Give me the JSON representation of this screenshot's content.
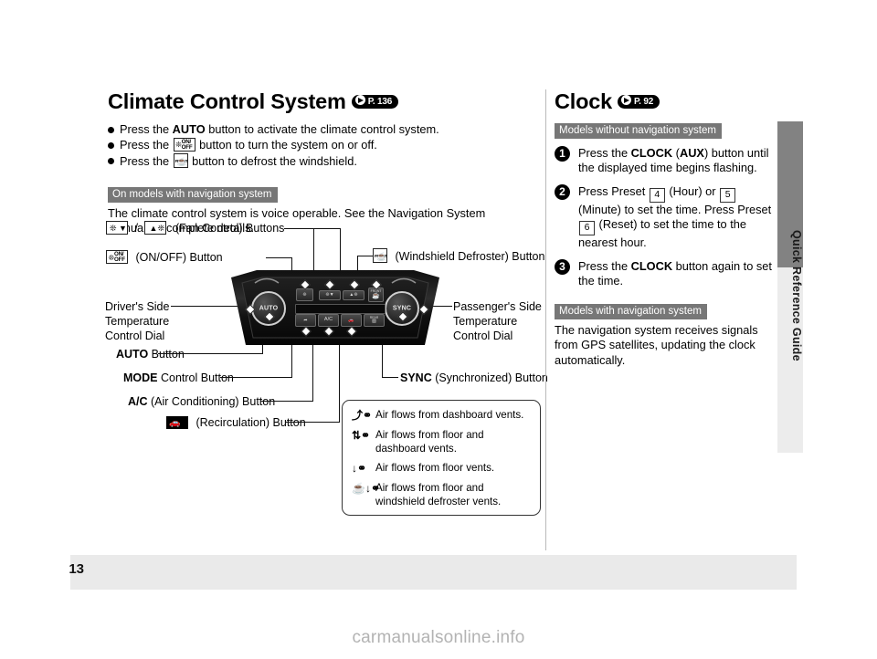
{
  "page": {
    "number": "13",
    "watermark": "carmanualsonline.info",
    "side_tab_label": "Quick Reference Guide"
  },
  "left_column": {
    "title": "Climate Control System",
    "title_ref": "P. 136",
    "bullets": [
      {
        "pre": "Press the ",
        "bold": "AUTO",
        "post": " button to activate the climate control system.",
        "icon": null
      },
      {
        "pre": "Press the ",
        "bold": "",
        "post": " button to turn the system on or off.",
        "icon": "fan-onoff-icon"
      },
      {
        "pre": "Press the ",
        "bold": "",
        "post": " button to defrost the windshield.",
        "icon": "front-defroster-icon"
      }
    ],
    "nav_banner": "On models with navigation system",
    "nav_text": "The climate control system is voice operable. See the Navigation System Manual for complete details."
  },
  "right_column": {
    "title": "Clock",
    "title_ref": "P. 92",
    "banner_without_nav": "Models without navigation system",
    "steps": [
      {
        "num": "1",
        "text_1": "Press the ",
        "bold_1": "CLOCK",
        "text_2": " (",
        "bold_2": "AUX",
        "text_3": ") button until the displayed time begins flashing."
      },
      {
        "num": "2",
        "text_1": "Press Preset ",
        "preset_a": "4",
        "text_2": " (Hour) or ",
        "preset_b": "5",
        "text_3": " (Minute) to set the time. Press Preset ",
        "preset_c": "6",
        "text_4": " (Reset) to set the time to the nearest hour."
      },
      {
        "num": "3",
        "text_1": "Press the ",
        "bold_1": "CLOCK",
        "text_2": " button again to set the time."
      }
    ],
    "banner_with_nav": "Models with navigation system",
    "nav_text": "The navigation system receives signals from GPS satellites, updating the clock automatically."
  },
  "diagram": {
    "labels": {
      "fan_control": "(Fan Control) Buttons",
      "fan_separator": "/",
      "on_off": "(ON/OFF) Button",
      "windshield_defroster": "(Windshield Defroster) Button",
      "drivers_dial_line1": "Driver's Side",
      "drivers_dial_line2": "Temperature",
      "drivers_dial_line3": "Control Dial",
      "passenger_dial_line1": "Passenger's Side",
      "passenger_dial_line2": "Temperature",
      "passenger_dial_line3": "Control Dial",
      "auto_bold": "AUTO",
      "auto_rest": " Button",
      "mode_bold": "MODE",
      "mode_rest": " Control Button",
      "ac_bold": "A/C",
      "ac_rest": " (Air Conditioning) Button",
      "recirc_rest": "(Recirculation) Button",
      "sync_bold": "SYNC",
      "sync_rest": " (Synchronized) Button"
    },
    "panel_buttons": {
      "auto": "AUTO",
      "sync": "SYNC",
      "mode": "MODE",
      "ac": "A/C",
      "rear_defrost": "REAR",
      "front_defrost": "FRONT"
    }
  },
  "legend": {
    "rows": [
      {
        "icon": "airflow-dashboard-icon",
        "text": "Air flows from dashboard vents."
      },
      {
        "icon": "airflow-floor-dashboard-icon",
        "text": "Air flows from floor and dashboard vents."
      },
      {
        "icon": "airflow-floor-icon",
        "text": "Air flows from floor vents."
      },
      {
        "icon": "airflow-floor-defroster-icon",
        "text": "Air flows from floor and windshield defroster vents."
      }
    ]
  }
}
